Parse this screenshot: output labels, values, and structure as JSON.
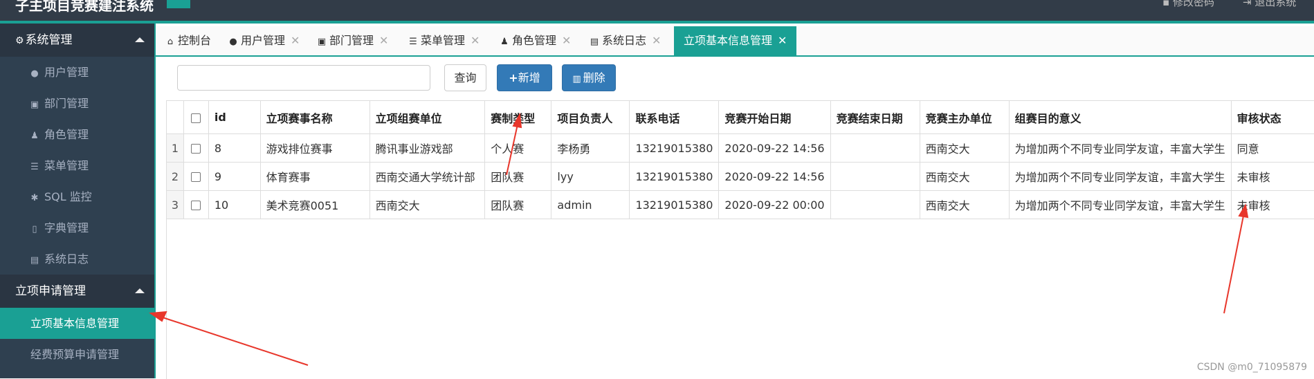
{
  "header": {
    "title": "子主项目竞赛建注系统",
    "change_password": "修改密码",
    "logout": "退出系统"
  },
  "sidebar": {
    "groups": [
      {
        "label": "系统管理",
        "items": [
          {
            "label": "用户管理",
            "icon": "user-icon"
          },
          {
            "label": "部门管理",
            "icon": "department-icon"
          },
          {
            "label": "角色管理",
            "icon": "role-icon"
          },
          {
            "label": "菜单管理",
            "icon": "menu-list-icon"
          },
          {
            "label": "SQL 监控",
            "icon": "bug-icon"
          },
          {
            "label": "字典管理",
            "icon": "bookmark-icon"
          },
          {
            "label": "系统日志",
            "icon": "log-file-icon"
          }
        ]
      },
      {
        "label": "立项申请管理",
        "items": [
          {
            "label": "立项基本信息管理",
            "active": true
          },
          {
            "label": "经费预算申请管理"
          }
        ]
      }
    ]
  },
  "tabs": [
    {
      "label": "控制台",
      "icon": "home-icon",
      "closable": false
    },
    {
      "label": "用户管理",
      "icon": "user-icon",
      "closable": true
    },
    {
      "label": "部门管理",
      "icon": "department-icon",
      "closable": true
    },
    {
      "label": "菜单管理",
      "icon": "menu-list-icon",
      "closable": true
    },
    {
      "label": "角色管理",
      "icon": "role-icon",
      "closable": true
    },
    {
      "label": "系统日志",
      "icon": "log-file-icon",
      "closable": true
    },
    {
      "label": "立项基本信息管理",
      "closable": true,
      "active": true
    }
  ],
  "toolbar": {
    "search_value": "",
    "query_label": "查询",
    "add_label": "新增",
    "delete_label": "删除"
  },
  "table": {
    "columns": [
      "id",
      "立项赛事名称",
      "立项组赛单位",
      "赛制类型",
      "项目负责人",
      "联系电话",
      "竞赛开始日期",
      "竞赛结束日期",
      "竞赛主办单位",
      "组赛目的意义",
      "审核状态"
    ],
    "rows": [
      {
        "no": "1",
        "cells": [
          "8",
          "游戏排位赛事",
          "腾讯事业游戏部",
          "个人赛",
          "李杨勇",
          "13219015380",
          "2020-09-22 14:56",
          "",
          "西南交大",
          "为增加两个不同专业同学友谊，丰富大学生",
          "同意"
        ]
      },
      {
        "no": "2",
        "cells": [
          "9",
          "体育赛事",
          "西南交通大学统计部",
          "团队赛",
          "lyy",
          "13219015380",
          "2020-09-22 14:56",
          "",
          "西南交大",
          "为增加两个不同专业同学友谊，丰富大学生",
          "未审核"
        ]
      },
      {
        "no": "3",
        "cells": [
          "10",
          "美术竞赛0051",
          "西南交大",
          "团队赛",
          "admin",
          "13219015380",
          "2020-09-22 00:00",
          "",
          "西南交大",
          "为增加两个不同专业同学友谊，丰富大学生",
          "未审核"
        ]
      }
    ]
  },
  "watermark": "CSDN @m0_71095879",
  "colors": {
    "accent": "#1aa094",
    "sidebar_bg": "#2f4050",
    "header_bg": "#323c48",
    "primary_button": "#337ab7",
    "arrow": "#e8362b"
  }
}
